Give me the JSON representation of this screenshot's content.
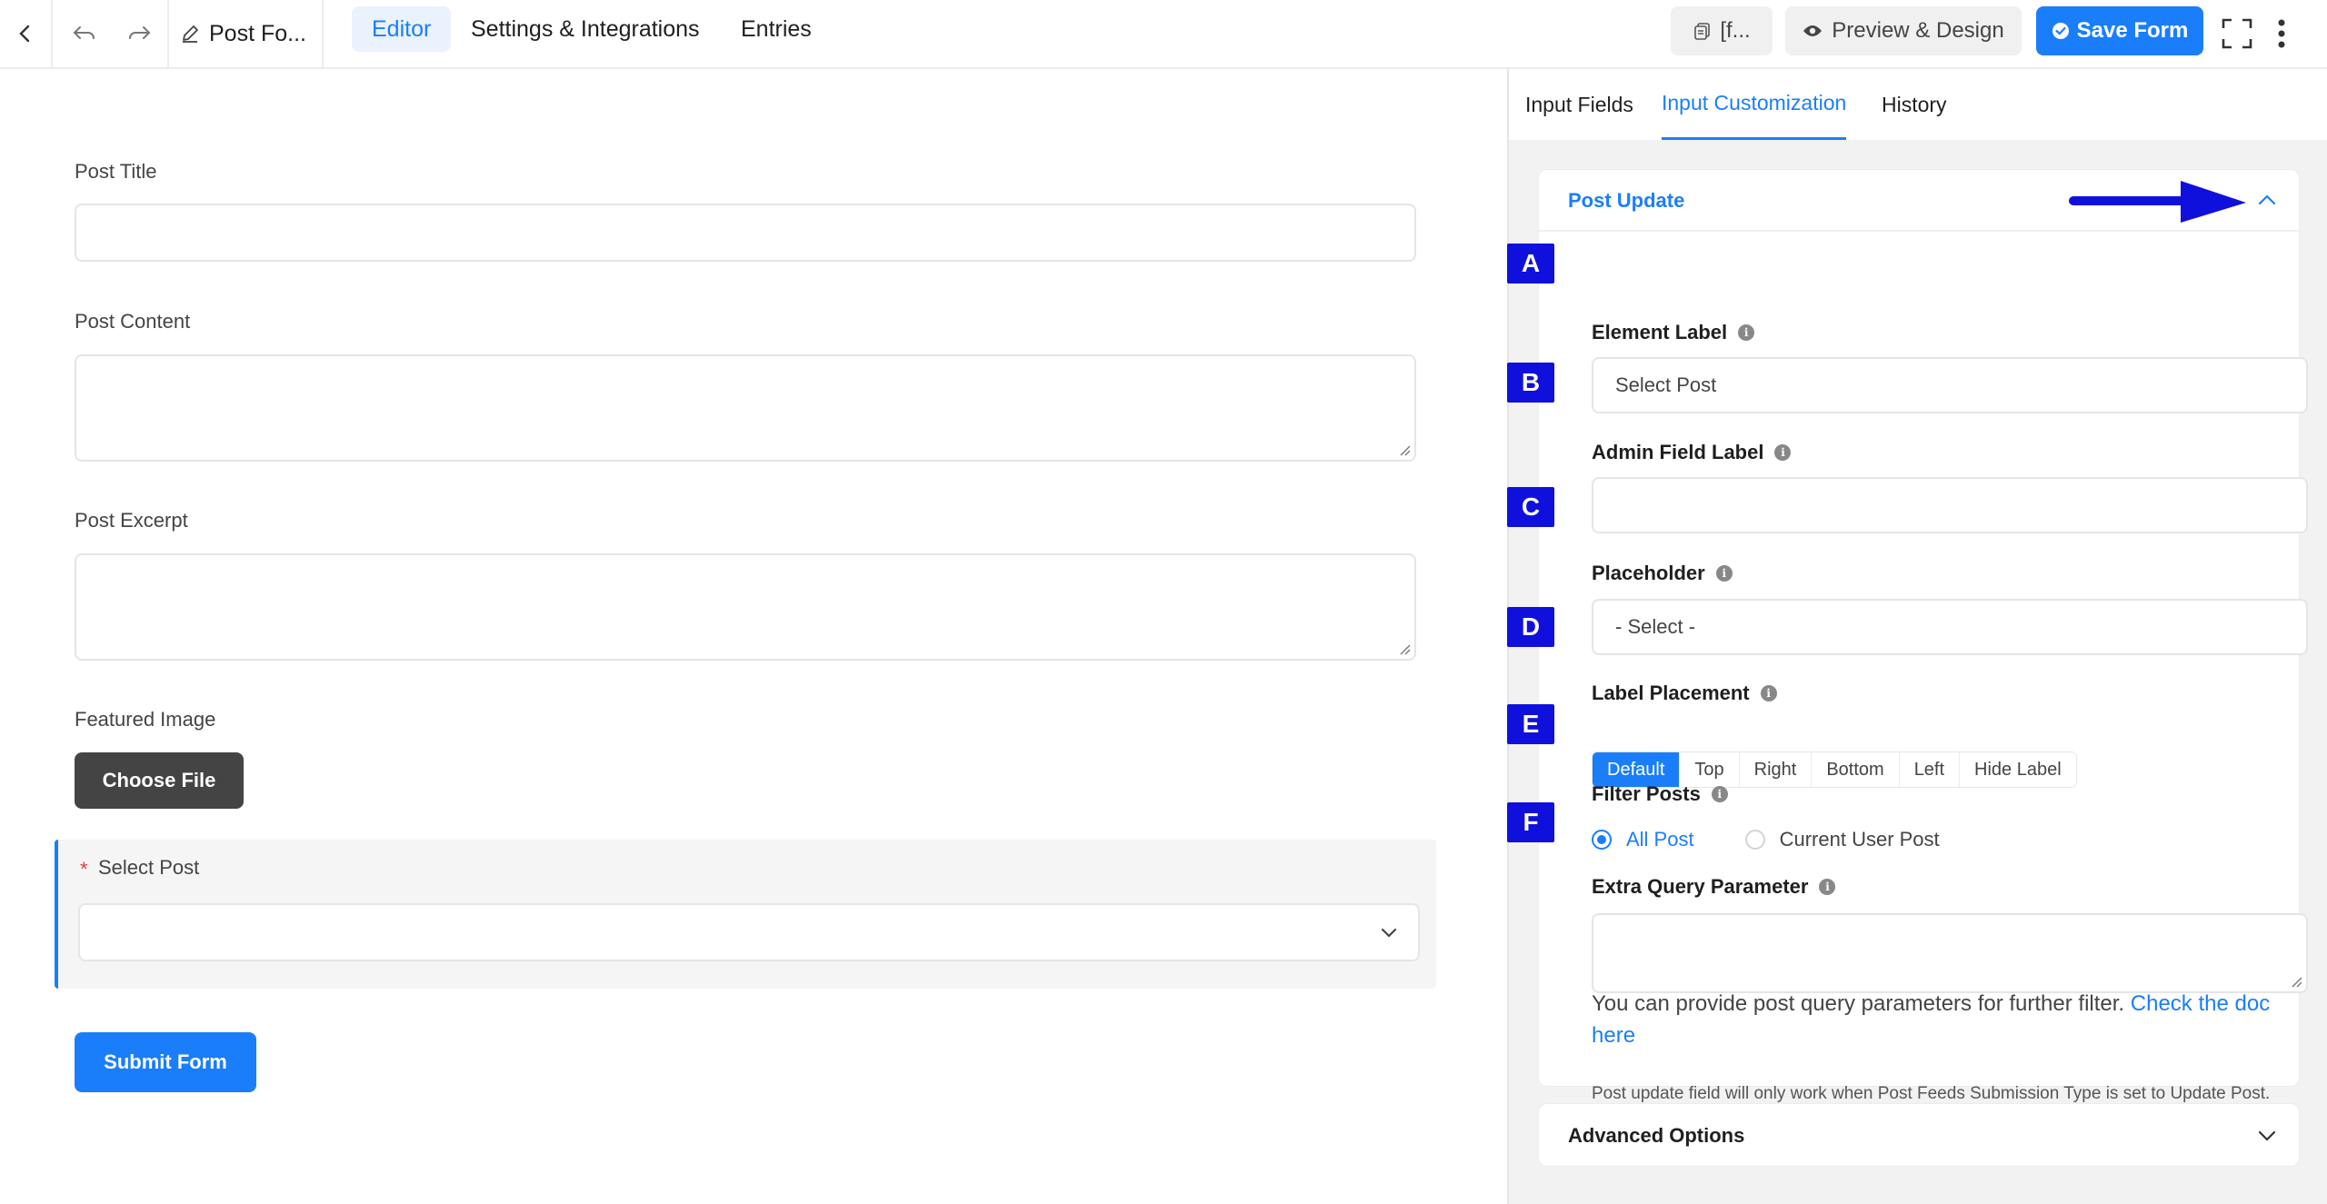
{
  "topbar": {
    "form_title": "Post Fo...",
    "tabs": [
      {
        "label": "Editor",
        "active": true
      },
      {
        "label": "Settings & Integrations",
        "active": false
      },
      {
        "label": "Entries",
        "active": false
      }
    ],
    "shortcode_label": "[f...",
    "preview_label": "Preview & Design",
    "save_label": "Save Form"
  },
  "form": {
    "fields": [
      {
        "label": "Post Title"
      },
      {
        "label": "Post Content"
      },
      {
        "label": "Post Excerpt"
      },
      {
        "label": "Featured Image"
      }
    ],
    "choose_file_label": "Choose File",
    "select_post": {
      "required_mark": "*",
      "label": "Select Post"
    },
    "submit_label": "Submit Form"
  },
  "panel": {
    "tabs": [
      {
        "label": "Input Fields",
        "active": false
      },
      {
        "label": "Input Customization",
        "active": true
      },
      {
        "label": "History",
        "active": false
      }
    ],
    "section_title": "Post Update",
    "markers": [
      "A",
      "B",
      "C",
      "D",
      "E",
      "F"
    ],
    "element_label": {
      "label": "Element Label",
      "value": "Select Post"
    },
    "admin_field_label": {
      "label": "Admin Field Label",
      "value": ""
    },
    "placeholder": {
      "label": "Placeholder",
      "value": "- Select -"
    },
    "label_placement": {
      "label": "Label Placement",
      "options": [
        "Default",
        "Top",
        "Right",
        "Bottom",
        "Left",
        "Hide Label"
      ],
      "selected": "Default"
    },
    "filter_posts": {
      "label": "Filter Posts",
      "options": [
        {
          "label": "All Post",
          "checked": true
        },
        {
          "label": "Current User Post",
          "checked": false
        }
      ]
    },
    "extra_query": {
      "label": "Extra Query Parameter",
      "help_text": "You can provide post query parameters for further filter.",
      "help_link": "Check the doc here"
    },
    "note": "Post update field will only work when Post Feeds Submission Type is set to Update Post.",
    "advanced_title": "Advanced Options"
  },
  "colors": {
    "accent": "#1a7efb",
    "marker": "#1010dd"
  }
}
